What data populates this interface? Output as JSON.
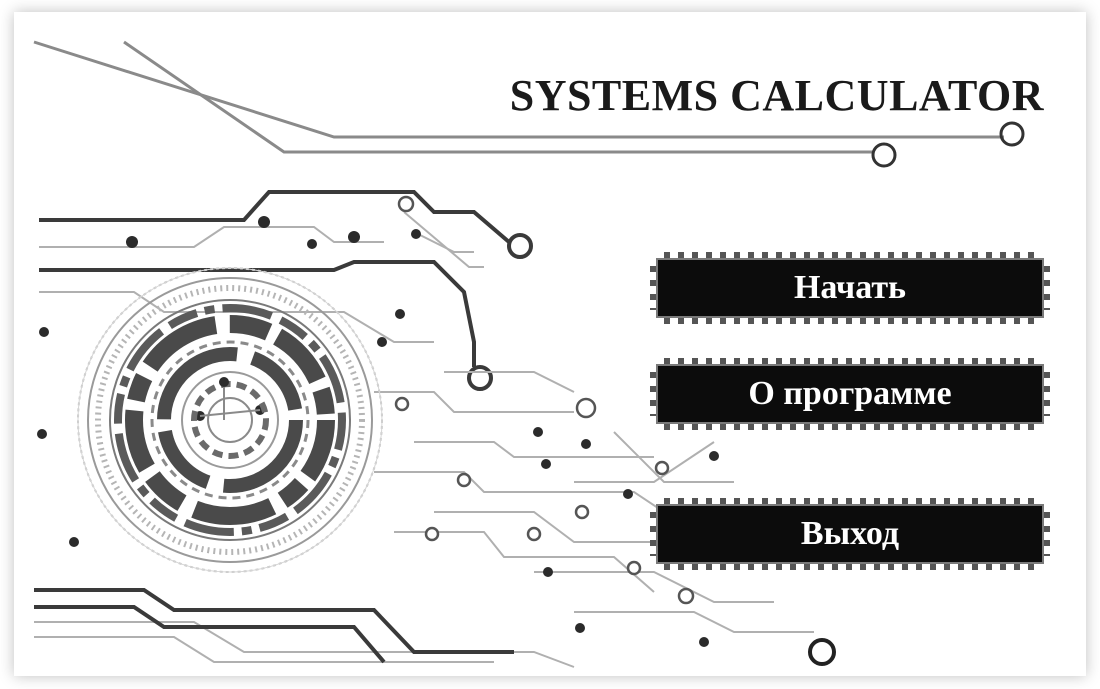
{
  "app": {
    "title": "SYSTEMS CALCULATOR"
  },
  "menu": {
    "start_label": "Начать",
    "about_label": "О программе",
    "exit_label": "Выход"
  },
  "theme": {
    "button_bg": "#0c0c0c",
    "button_text": "#ffffff",
    "circuit_line": "#9a9a9a",
    "circuit_dark": "#3a3a3a"
  },
  "decor": {
    "background_icon": "circuit-board-pattern",
    "emblem_icon": "circular-circuit-emblem"
  }
}
